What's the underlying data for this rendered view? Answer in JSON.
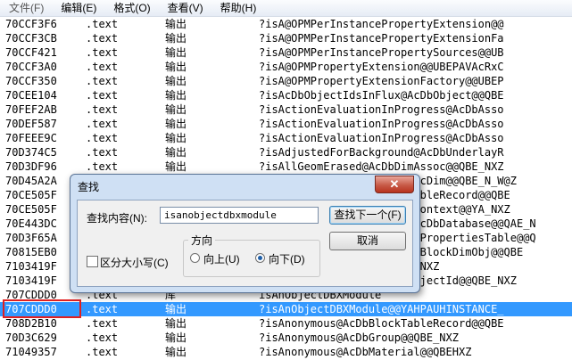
{
  "menu": [
    "文件(F)",
    "编辑(E)",
    "格式(O)",
    "查看(V)",
    "帮助(H)"
  ],
  "rows": [
    {
      "addr": "70CCF3F6",
      "sec": ".text",
      "type": "输出",
      "sym": "?isA@OPMPerInstancePropertyExtension@@"
    },
    {
      "addr": "70CCF3CB",
      "sec": ".text",
      "type": "输出",
      "sym": "?isA@OPMPerInstancePropertyExtensionFa"
    },
    {
      "addr": "70CCF421",
      "sec": ".text",
      "type": "输出",
      "sym": "?isA@OPMPerInstancePropertySources@@UB"
    },
    {
      "addr": "70CCF3A0",
      "sec": ".text",
      "type": "输出",
      "sym": "?isA@OPMPropertyExtension@@UBEPAVAcRxC"
    },
    {
      "addr": "70CCF350",
      "sec": ".text",
      "type": "输出",
      "sym": "?isA@OPMPropertyExtensionFactory@@UBEP"
    },
    {
      "addr": "70CEE104",
      "sec": ".text",
      "type": "输出",
      "sym": "?isAcDbObjectIdsInFlux@AcDbObject@@QBE"
    },
    {
      "addr": "70FEF2AB",
      "sec": ".text",
      "type": "输出",
      "sym": "?isActionEvaluationInProgress@AcDbAsso"
    },
    {
      "addr": "70DEF587",
      "sec": ".text",
      "type": "输出",
      "sym": "?isActionEvaluationInProgress@AcDbAsso"
    },
    {
      "addr": "70FEEE9C",
      "sec": ".text",
      "type": "输出",
      "sym": "?isActionEvaluationInProgress@AcDbAsso"
    },
    {
      "addr": "70D374C5",
      "sec": ".text",
      "type": "输出",
      "sym": "?isAdjustedForBackground@AcDbUnderlayR"
    },
    {
      "addr": "70D3DF96",
      "sec": ".text",
      "type": "输出",
      "sym": "?isAllGeomErased@AcDbDimAssoc@@QBE_NXZ"
    },
    {
      "addr": "70D45A2A",
      "sec": ".text",
      "type": "输出",
      "sym": "?isAlwaysShowDim@AcDbAssocDim@@QBE_N_W@Z"
    },
    {
      "addr": "70CE505F",
      "sec": ".text",
      "type": "输出",
      "sym": "?isAncestorOf@AcDbBlockTableRecord@@QBE"
    },
    {
      "addr": "70CE505F",
      "sec": ".text",
      "type": "输出",
      "sym": "?isAnnotative@AcDbObjectContext@@YA_NXZ"
    },
    {
      "addr": "70E443DC",
      "sec": ".text",
      "type": "输出",
      "sym": "?isAnnotativeScaleTable@AcDbDatabase@@QAE_N"
    },
    {
      "addr": "70D3F65A",
      "sec": ".text",
      "type": "输出",
      "sym": "?isAnonymous@AcDbDimStylePropertiesTable@@Q"
    },
    {
      "addr": "70815EB0",
      "sec": ".text",
      "type": "输出",
      "sym": "?isAnonymousBlock@AcDbDynBlockDimObj@@QBE"
    },
    {
      "addr": "7103419F",
      "sec": ".text",
      "type": "输出",
      "sym": "?isAnObjectDBXModule@@YA_NXZ"
    },
    {
      "addr": "7103419F",
      "sec": ".text",
      "type": "输出",
      "sym": "?isAnonymousObject@AcDbObjectId@@QBE_NXZ"
    },
    {
      "addr": "707CDDD0",
      "sec": ".text",
      "type": "库",
      "sym": "isAnObjectDBXModule"
    },
    {
      "addr": "707CDDD0",
      "sec": ".text",
      "type": "输出",
      "sym": "?isAnObjectDBXModule@@YAHPAUHINSTANCE_"
    },
    {
      "addr": "708D2B10",
      "sec": ".text",
      "type": "输出",
      "sym": "?isAnonymous@AcDbBlockTableRecord@@QBE"
    },
    {
      "addr": "70D3C629",
      "sec": ".text",
      "type": "输出",
      "sym": "?isAnonymous@AcDbGroup@@QBE_NXZ"
    },
    {
      "addr": "71049357",
      "sec": ".text",
      "type": "输出",
      "sym": "?isAnonymous@AcDbMaterial@@QBEHXZ"
    }
  ],
  "selected_index": 20,
  "dialog": {
    "title": "查找",
    "close_symbol": "✕",
    "find_label": "查找内容(N):",
    "find_value": "isanobjectdbxmodule",
    "find_next_label": "查找下一个(F)",
    "cancel_label": "取消",
    "match_case_label": "区分大小写(C)",
    "match_case_checked": false,
    "direction_label": "方向",
    "up_label": "向上(U)",
    "down_label": "向下(D)",
    "direction": "down"
  }
}
